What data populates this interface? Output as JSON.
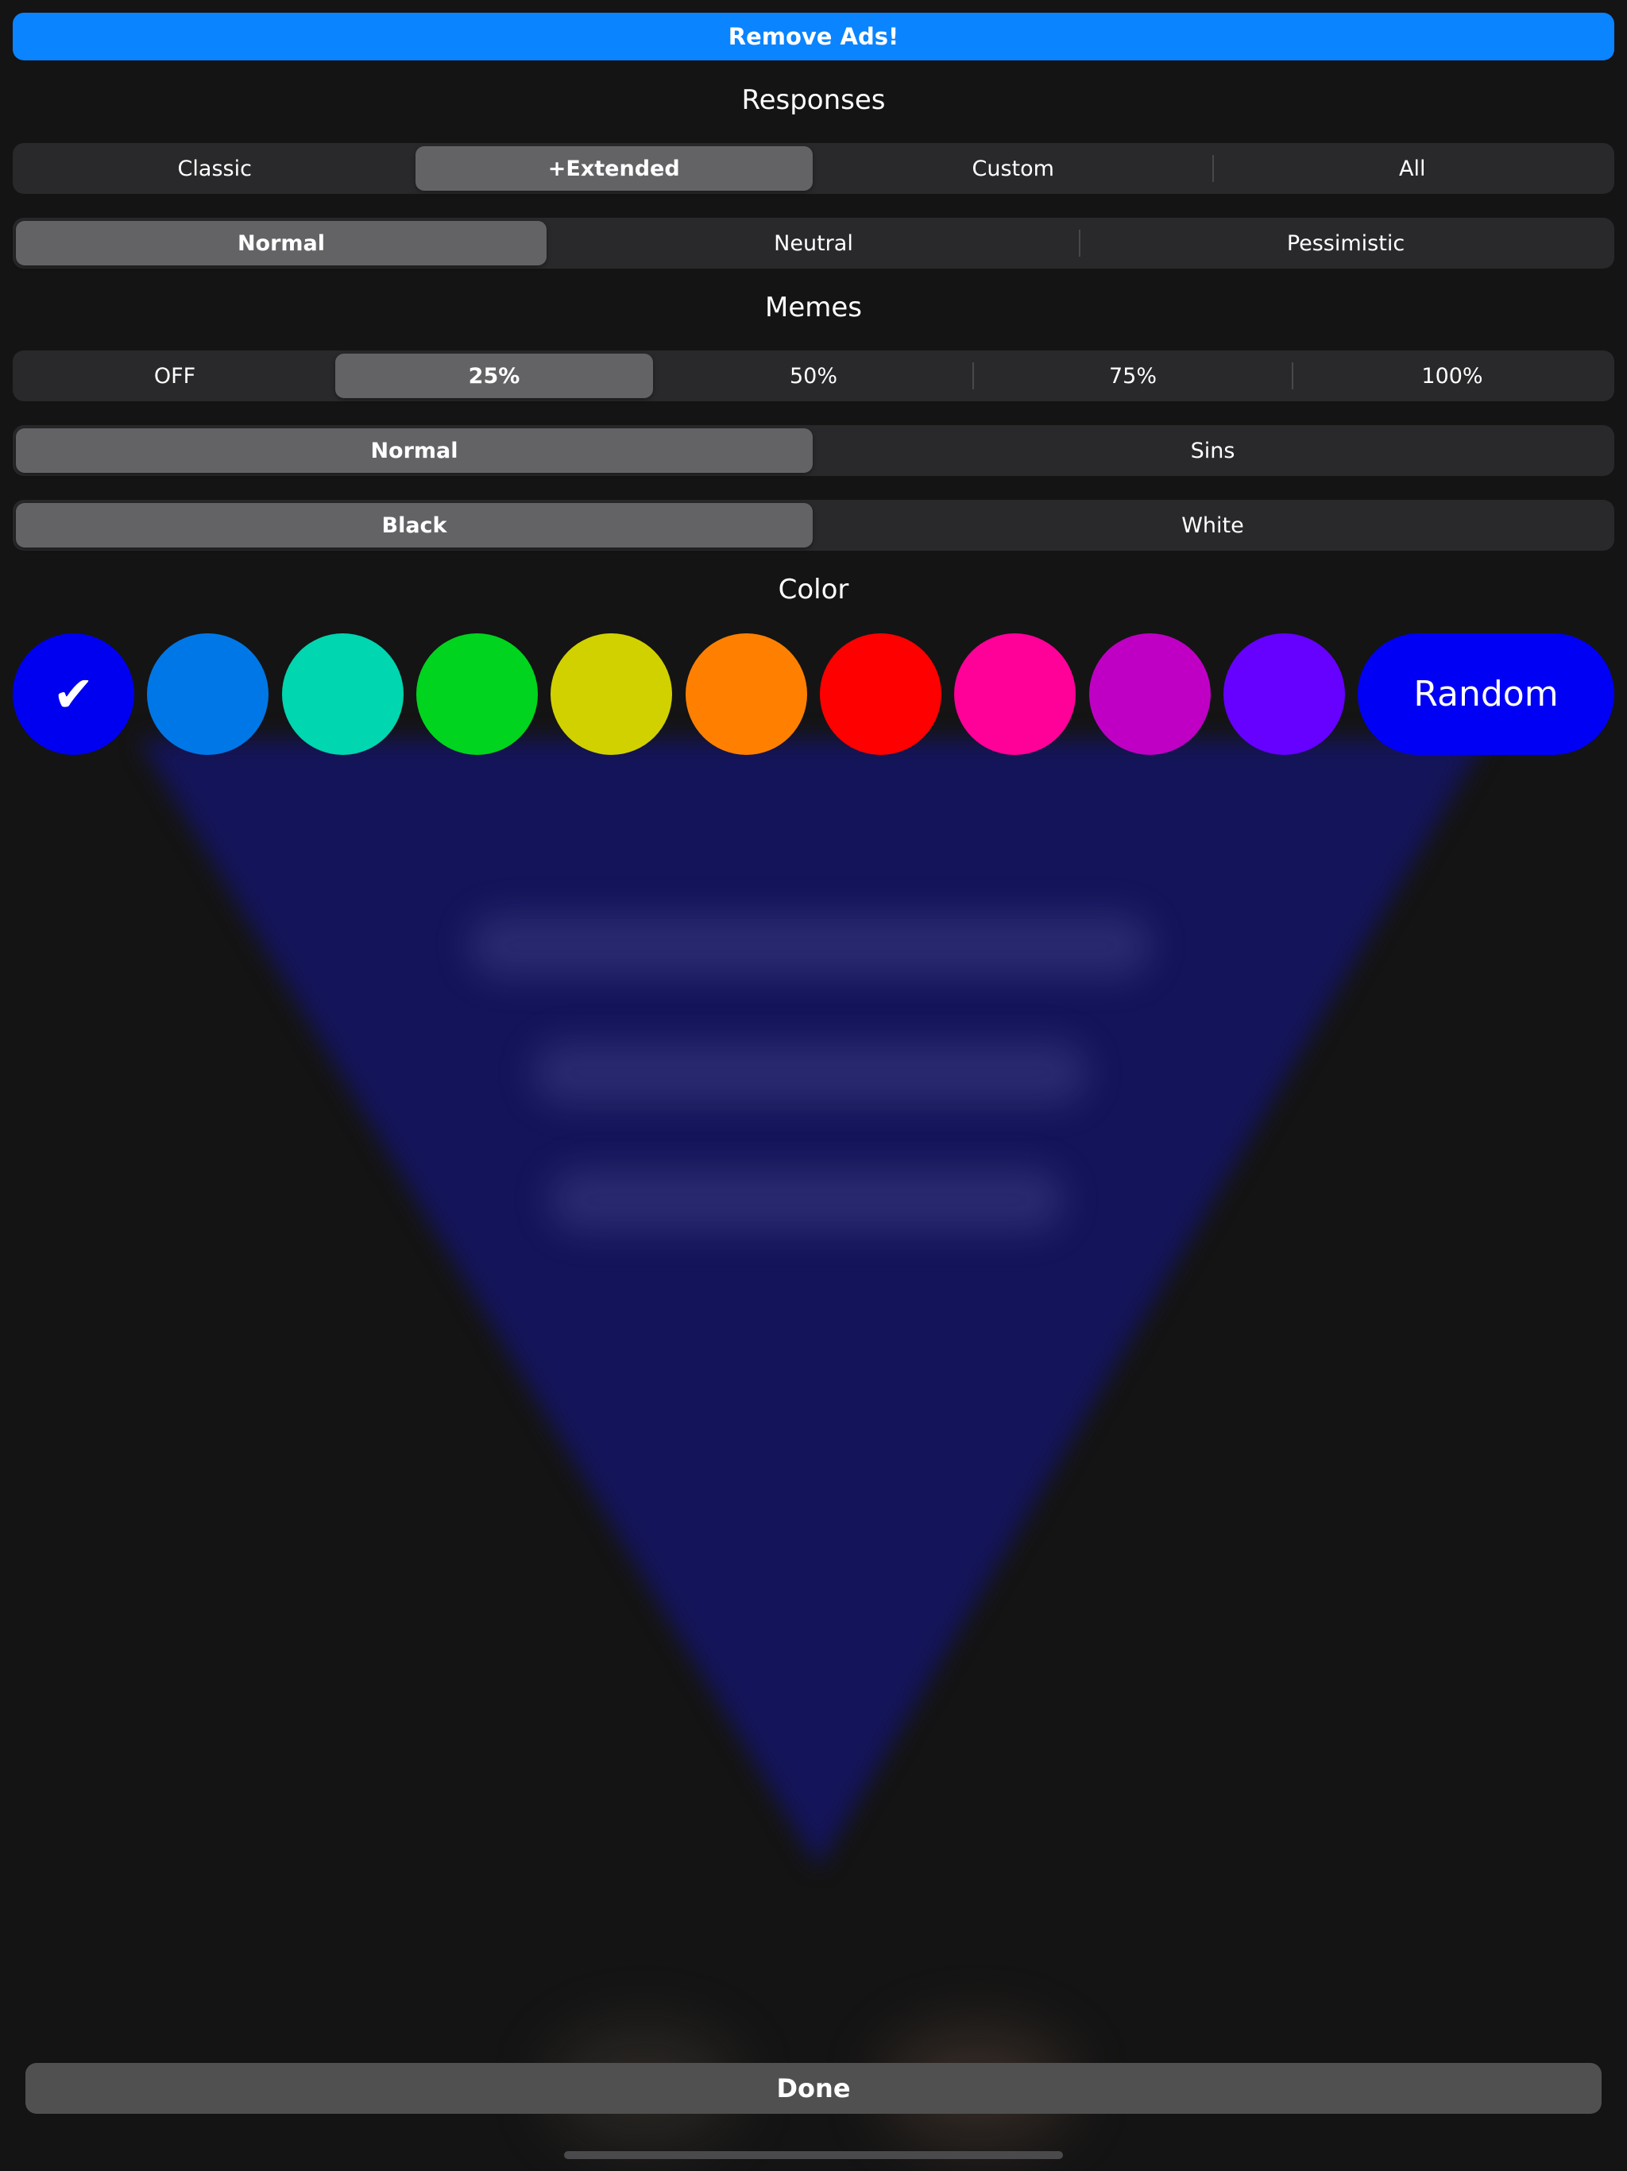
{
  "header": {
    "remove_ads_label": "Remove Ads!"
  },
  "responses": {
    "title": "Responses",
    "set_options": [
      "Classic",
      "+Extended",
      "Custom",
      "All"
    ],
    "set_selected": "+Extended",
    "tone_options": [
      "Normal",
      "Neutral",
      "Pessimistic"
    ],
    "tone_selected": "Normal"
  },
  "memes": {
    "title": "Memes",
    "frequency_options": [
      "OFF",
      "25%",
      "50%",
      "75%",
      "100%"
    ],
    "frequency_selected": "25%",
    "style_options": [
      "Normal",
      "Sins"
    ],
    "style_selected": "Normal",
    "background_options": [
      "Black",
      "White"
    ],
    "background_selected": "Black"
  },
  "color": {
    "title": "Color",
    "selected_mark": "✔",
    "swatches": [
      {
        "name": "blue",
        "hex": "#0000f0",
        "selected": true
      },
      {
        "name": "sky-blue",
        "hex": "#0077e6",
        "selected": false
      },
      {
        "name": "teal",
        "hex": "#00d6b0",
        "selected": false
      },
      {
        "name": "green",
        "hex": "#00d41e",
        "selected": false
      },
      {
        "name": "yellow",
        "hex": "#d2d100",
        "selected": false
      },
      {
        "name": "orange",
        "hex": "#ff8000",
        "selected": false
      },
      {
        "name": "red",
        "hex": "#ff0000",
        "selected": false
      },
      {
        "name": "pink",
        "hex": "#ff0099",
        "selected": false
      },
      {
        "name": "magenta",
        "hex": "#bf00c4",
        "selected": false
      },
      {
        "name": "violet",
        "hex": "#6600ff",
        "selected": false
      }
    ],
    "random_label": "Random",
    "random_hex": "#0000f5"
  },
  "footer": {
    "done_label": "Done"
  },
  "theme": {
    "accent": "#0a84ff",
    "background": "#141414",
    "segment_bg": "#29292b",
    "segment_selected": "#636366",
    "answer_triangle": "#14145a"
  }
}
